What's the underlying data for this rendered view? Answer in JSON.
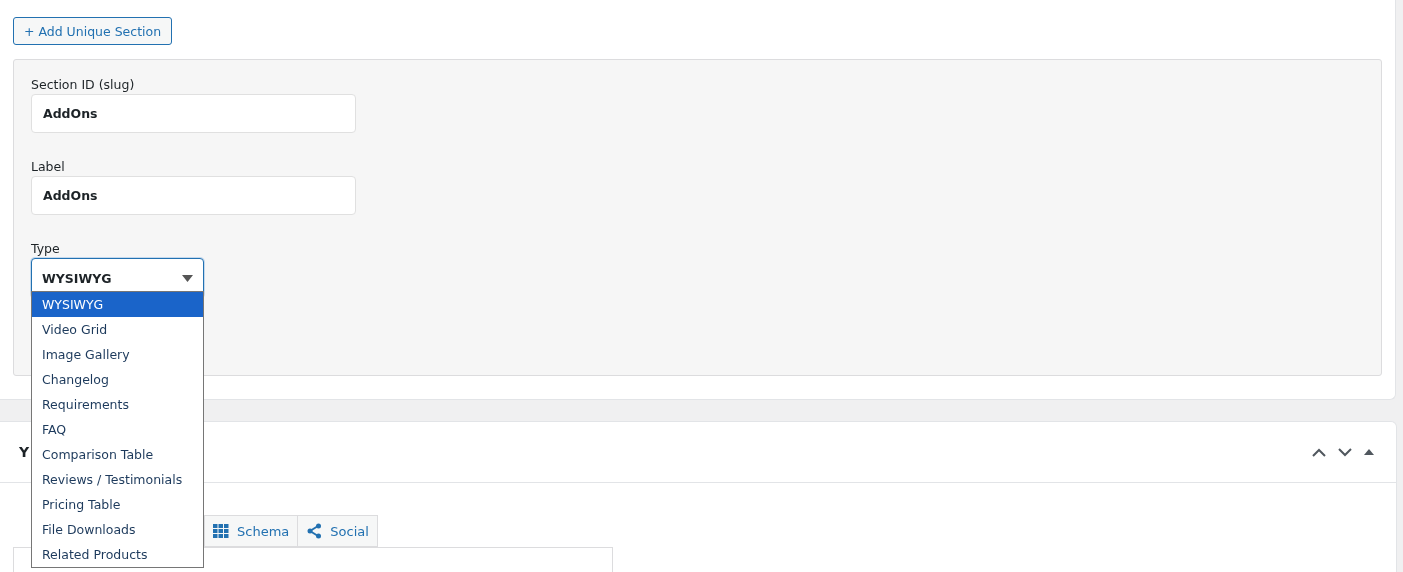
{
  "add_button": {
    "label": "+ Add Unique Section"
  },
  "fields": [
    {
      "label": "Section ID (slug)",
      "value": "AddOns"
    },
    {
      "label": "Label",
      "value": "AddOns"
    }
  ],
  "type_select": {
    "label": "Type",
    "value": "WYSIWYG",
    "expanded": true,
    "options": [
      {
        "label": "WYSIWYG",
        "selected": true
      },
      {
        "label": "Video Grid",
        "selected": false
      },
      {
        "label": "Image Gallery",
        "selected": false
      },
      {
        "label": "Changelog",
        "selected": false
      },
      {
        "label": "Requirements",
        "selected": false
      },
      {
        "label": "FAQ",
        "selected": false
      },
      {
        "label": "Comparison Table",
        "selected": false
      },
      {
        "label": "Reviews / Testimonials",
        "selected": false
      },
      {
        "label": "Pricing Table",
        "selected": false
      },
      {
        "label": "File Downloads",
        "selected": false
      },
      {
        "label": "Related Products",
        "selected": false
      }
    ]
  },
  "panel": {
    "title": "Y",
    "tabs": [
      {
        "label": "Schema",
        "kind": "grid",
        "selected": false
      },
      {
        "label": "Social",
        "kind": "share",
        "selected": false
      }
    ]
  }
}
